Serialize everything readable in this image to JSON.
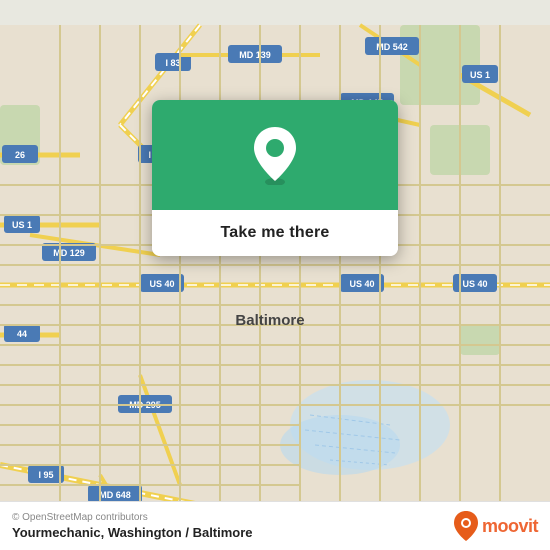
{
  "map": {
    "bg_color": "#e8e8e0",
    "alt": "Baltimore street map"
  },
  "popup": {
    "button_label": "Take me there",
    "bg_color": "#2eaa6e"
  },
  "bottom_bar": {
    "osm_credit": "© OpenStreetMap contributors",
    "location_title": "Yourmechanic, Washington / Baltimore",
    "moovit_text": "moovit"
  }
}
